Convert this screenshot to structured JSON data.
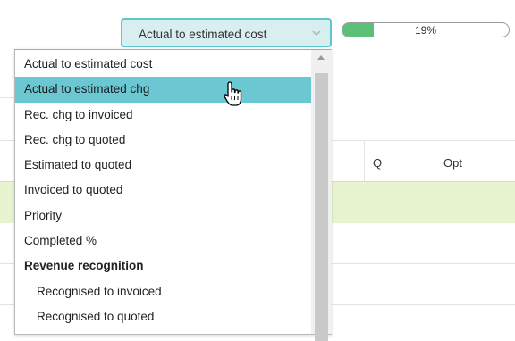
{
  "select": {
    "value": "Actual to estimated cost"
  },
  "progress": {
    "percent": 19,
    "label": "19%"
  },
  "table": {
    "columns": [
      "Q",
      "Opt"
    ]
  },
  "options": [
    {
      "label": "Actual to estimated cost"
    },
    {
      "label": "Actual to estimated chg",
      "selected": true
    },
    {
      "label": "Rec. chg to invoiced"
    },
    {
      "label": "Rec. chg to quoted"
    },
    {
      "label": "Estimated to quoted"
    },
    {
      "label": "Invoiced to quoted"
    },
    {
      "label": "Priority"
    },
    {
      "label": "Completed %"
    },
    {
      "label": "Revenue recognition",
      "group": true
    },
    {
      "label": "Recognised to invoiced",
      "indent": true
    },
    {
      "label": "Recognised to quoted",
      "indent": true
    }
  ],
  "icons": {
    "dropdown_arrow": "chevron-down-icon",
    "scroll_up": "scroll-up-arrow-icon",
    "cursor": "hand-pointer-icon"
  },
  "colors": {
    "accent": "#5fc6cf",
    "selected_option": "#6bc7d1",
    "progress_fill": "#5cc078",
    "highlight_row": "#e7f4cf"
  }
}
